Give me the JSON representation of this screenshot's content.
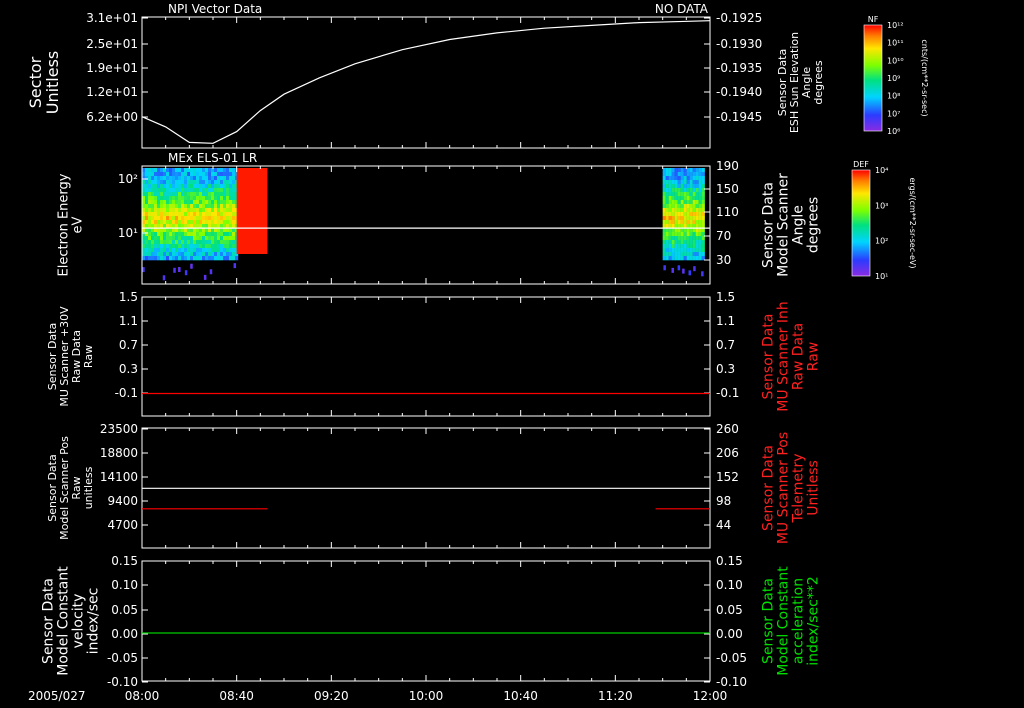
{
  "time_axis": {
    "date": "2005/027",
    "ticks": [
      "08:00",
      "08:40",
      "09:20",
      "10:00",
      "10:40",
      "11:20",
      "12:00"
    ],
    "range_minutes": [
      0,
      240
    ]
  },
  "colorbars": [
    {
      "label": "NF",
      "unit": "cnts/(cm**2-sr-sec)",
      "ticks": [
        "10¹²",
        "10¹¹",
        "10¹⁰",
        "10⁹",
        "10⁸",
        "10⁷",
        "10⁶"
      ]
    },
    {
      "label": "DEF",
      "unit": "ergs/(cm**2-sr-sec-eV)",
      "ticks": [
        "10⁴",
        "10³",
        "10²",
        "10¹"
      ]
    }
  ],
  "chart_data": [
    {
      "type": "line",
      "title": "NPI Vector Data",
      "status": "NO DATA",
      "ylabel_left": [
        "Sector",
        "Unitless"
      ],
      "left_ticks": [
        "3.1e+01",
        "2.5e+01",
        "1.9e+01",
        "1.2e+01",
        "6.2e+00"
      ],
      "ylabel_right": [
        "Sensor Data",
        "ESH Sun Elevation",
        "Angle",
        "degrees"
      ],
      "right_ticks": [
        "-0.1925",
        "-0.1930",
        "-0.1935",
        "-0.1940",
        "-0.1945"
      ],
      "ylim_right": [
        -0.195,
        -0.1922
      ],
      "series": [
        {
          "x": [
            0,
            10,
            20,
            30,
            40,
            50,
            60,
            75,
            90,
            110,
            130,
            150,
            170,
            190,
            210,
            225,
            240
          ],
          "y": [
            -0.19433,
            -0.19455,
            -0.19488,
            -0.1949,
            -0.19465,
            -0.1942,
            -0.19385,
            -0.1935,
            -0.1932,
            -0.1929,
            -0.19268,
            -0.19254,
            -0.19244,
            -0.19238,
            -0.19232,
            -0.1923,
            -0.19228
          ]
        }
      ]
    },
    {
      "type": "heatmap",
      "title": "MEx ELS-01 LR",
      "ylabel_left": [
        "Electron Energy",
        "eV"
      ],
      "left_ticks": [
        "10²",
        "10¹"
      ],
      "ylabel_right": [
        "Sensor Data",
        "Model Scanner",
        "Angle",
        "degrees"
      ],
      "right_ticks": [
        "190",
        "150",
        "110",
        "70",
        "30"
      ],
      "ylim_right": [
        0,
        190
      ],
      "data_blocks": [
        {
          "start": 0,
          "end": 40,
          "kind": "spectrum"
        },
        {
          "start": 40,
          "end": 53,
          "kind": "saturated"
        },
        {
          "start": 220,
          "end": 237,
          "kind": "spectrum"
        }
      ],
      "series": [
        {
          "line": "white",
          "x": [
            0,
            240
          ],
          "y": [
            90,
            90
          ]
        }
      ]
    },
    {
      "type": "line",
      "ylabel_left": [
        "Sensor Data",
        "MU Scanner +30V",
        "Raw Data",
        "Raw"
      ],
      "left_ticks": [
        "1.5",
        "1.1",
        "0.7",
        "0.3",
        "-0.1"
      ],
      "ylabel_right": [
        "Sensor Data",
        "MU Scanner Inh",
        "Raw Data",
        "Raw"
      ],
      "right_ticks": [
        "1.5",
        "1.1",
        "0.7",
        "0.3",
        "-0.1"
      ],
      "ylim": [
        -0.35,
        1.5
      ],
      "series": [
        {
          "color": "#ff0000",
          "x": [
            0,
            240
          ],
          "y": [
            0.0,
            0.0
          ]
        }
      ]
    },
    {
      "type": "line",
      "ylabel_left": [
        "Sensor Data",
        "Model Scanner Pos",
        "Raw",
        "unitless"
      ],
      "left_ticks": [
        "23500",
        "18800",
        "14100",
        "9400",
        "4700"
      ],
      "ylabel_right": [
        "Sensor Data",
        "MU Scanner Pos",
        "Telemetry",
        "Unitless"
      ],
      "right_ticks": [
        "260",
        "206",
        "152",
        "98",
        "44"
      ],
      "ylim_left": [
        0,
        23500
      ],
      "ylim_right": [
        0,
        260
      ],
      "series": [
        {
          "axis": "left",
          "color": "#ffffff",
          "x": [
            0,
            240
          ],
          "y": [
            11700,
            11700
          ]
        },
        {
          "axis": "right",
          "color": "#ff0000",
          "x": [
            0,
            53
          ],
          "y": [
            85,
            85
          ]
        },
        {
          "axis": "right",
          "color": "#ff0000",
          "x": [
            217,
            240
          ],
          "y": [
            85,
            85
          ]
        }
      ]
    },
    {
      "type": "line",
      "ylabel_left": [
        "Sensor Data",
        "Model Constant",
        "velocity",
        "index/sec"
      ],
      "left_ticks": [
        "0.15",
        "0.10",
        "0.05",
        "0.00",
        "-0.05",
        "-0.10"
      ],
      "ylabel_right": [
        "Sensor Data",
        "Model Constant",
        "acceleration",
        "index/sec**2"
      ],
      "right_ticks": [
        "0.15",
        "0.10",
        "0.05",
        "0.00",
        "-0.05",
        "-0.10"
      ],
      "ylim": [
        -0.1,
        0.15
      ],
      "series": [
        {
          "color": "#00cc00",
          "x": [
            0,
            240
          ],
          "y": [
            0.0,
            0.0
          ]
        }
      ]
    }
  ]
}
